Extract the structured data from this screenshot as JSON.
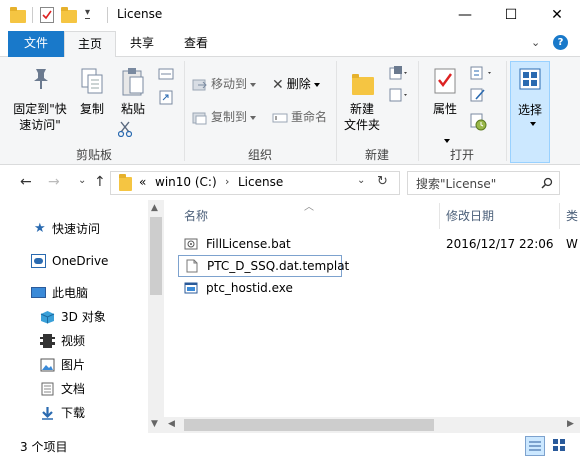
{
  "window": {
    "title": "License",
    "minimize_glyph": "—",
    "maximize_glyph": "☐",
    "close_glyph": "✕"
  },
  "tabs": [
    {
      "label": "文件"
    },
    {
      "label": "主页"
    },
    {
      "label": "共享"
    },
    {
      "label": "查看"
    }
  ],
  "ribbon": {
    "groups": {
      "clipboard": {
        "label": "剪贴板",
        "pin_label_line1": "固定到\"快",
        "pin_label_line2": "速访问\"",
        "copy_label": "复制",
        "paste_label": "粘贴"
      },
      "organize": {
        "label": "组织",
        "move_to": "移动到",
        "copy_to": "复制到",
        "delete": "删除",
        "rename": "重命名"
      },
      "new": {
        "label": "新建",
        "new_folder_line1": "新建",
        "new_folder_line2": "文件夹"
      },
      "open": {
        "label": "打开",
        "properties": "属性"
      },
      "select": {
        "label": "选择"
      }
    }
  },
  "address": {
    "prefix": "«",
    "segments": [
      "win10 (C:)",
      "License"
    ],
    "search_placeholder": "搜索\"License\""
  },
  "navpane": {
    "items": [
      {
        "label": "快速访问",
        "icon": "star-icon"
      },
      {
        "label": "OneDrive",
        "icon": "cloud-icon"
      },
      {
        "label": "此电脑",
        "icon": "computer-icon"
      },
      {
        "label": "3D 对象",
        "icon": "cube-icon"
      },
      {
        "label": "视频",
        "icon": "video-icon"
      },
      {
        "label": "图片",
        "icon": "image-icon"
      },
      {
        "label": "文档",
        "icon": "document-icon"
      },
      {
        "label": "下载",
        "icon": "download-icon"
      }
    ]
  },
  "filelist": {
    "columns": {
      "name": "名称",
      "date": "修改日期",
      "type_partial": "类"
    },
    "files": [
      {
        "name": "FillLicense.bat",
        "date": "2016/12/17 22:06",
        "type_partial": "W",
        "icon": "batch-file-icon"
      },
      {
        "name": "PTC_D_SSQ.dat.templat",
        "date": "",
        "type_partial": "",
        "icon": "blank-file-icon"
      },
      {
        "name": "ptc_hostid.exe",
        "date": "",
        "type_partial": "",
        "icon": "exe-file-icon"
      }
    ]
  },
  "statusbar": {
    "count": "3 个项目"
  },
  "colors": {
    "accent": "#1979ca",
    "folder": "#f5c542",
    "select_highlight": "#cce8ff"
  }
}
